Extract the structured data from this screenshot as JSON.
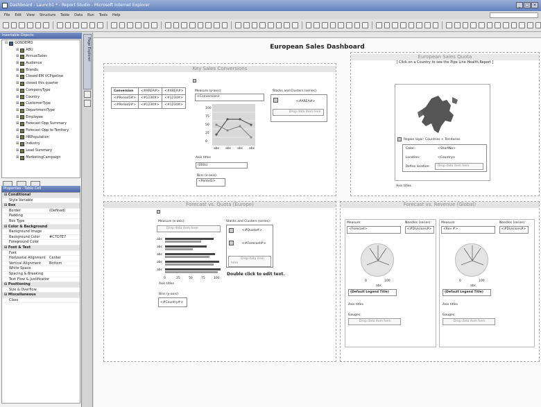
{
  "window": {
    "title": "Dashboard - Launch1 * - Report Studio - Microsoft Internet Explorer"
  },
  "menu": [
    "File",
    "Edit",
    "View",
    "Structure",
    "Table",
    "Data",
    "Run",
    "Tools",
    "Help"
  ],
  "left": {
    "objects_title": "Insertable Objects",
    "tree_root": "GOSDEMO",
    "tree": [
      "ABU",
      "AnnualSales",
      "Audience",
      "Brands",
      "Closed EM VCPipeline",
      "closed this quarter",
      "CompanyType",
      "Country",
      "CustomerType",
      "DepartmentType",
      "Employee",
      "Forecast Opp Summary",
      "Forecast Opp to Territory",
      "HRPopulation",
      "Industry",
      "Lead Summary",
      "MarketingCampaign"
    ],
    "props_title": "Properties - Table Cell",
    "props": [
      {
        "k": "Conditional",
        "v": "",
        "sec": true
      },
      {
        "k": "Style Variable",
        "v": ""
      },
      {
        "k": "Box",
        "v": "",
        "sec": true
      },
      {
        "k": "Border",
        "v": "(Defined)"
      },
      {
        "k": "Padding",
        "v": ""
      },
      {
        "k": "Box Type",
        "v": ""
      },
      {
        "k": "Color & Background",
        "v": "",
        "sec": true
      },
      {
        "k": "Background Image",
        "v": ""
      },
      {
        "k": "Background Color",
        "v": "#C7D7E7"
      },
      {
        "k": "Foreground Color",
        "v": ""
      },
      {
        "k": "Font & Text",
        "v": "",
        "sec": true
      },
      {
        "k": "Font",
        "v": ""
      },
      {
        "k": "Horizontal Alignment",
        "v": "Center"
      },
      {
        "k": "Vertical Alignment",
        "v": "Bottom"
      },
      {
        "k": "White Space",
        "v": ""
      },
      {
        "k": "Spacing & Breaking",
        "v": ""
      },
      {
        "k": "Text Flow & Justification",
        "v": ""
      },
      {
        "k": "Positioning",
        "v": "",
        "sec": true
      },
      {
        "k": "Size & Overflow",
        "v": ""
      },
      {
        "k": "Miscellaneous",
        "v": "",
        "sec": true
      },
      {
        "k": "Class",
        "v": ""
      }
    ]
  },
  "side": {
    "page_explorer": "Page Explorer"
  },
  "dash": {
    "title": "European Sales Dashboard",
    "kpi": {
      "title": "Key Sales Conversions",
      "crosstab": [
        [
          "Conversion",
          "<#AREA#>",
          "<#AREA#>"
        ],
        [
          "<#Period1#>",
          "<#1234#>",
          "<#1234#>"
        ],
        [
          "<#Period2#>",
          "<#1234#>",
          "<#1234#>"
        ]
      ],
      "measure_label": "Measure (y-axis):",
      "measure": "<Conversion>",
      "series_label": "Stacks and Clusters (series):",
      "series": "<#AREA#>",
      "drop": "Drop data item here",
      "yticks": [
        "100",
        "75",
        "50",
        "25",
        "0"
      ],
      "xticks": [
        "abc",
        "abc",
        "abc",
        "abc"
      ],
      "axis_titles": "Axis titles",
      "axis_box": "(000s)",
      "bins_label": "Bins (x-axis):",
      "bins": "<Period1>"
    },
    "quota": {
      "title": "European Sales Quota",
      "sub": "[ Click on a Country to see the Pipe Line Health Report ]",
      "region": "Region layer: Countries + Territories",
      "color_k": "Color:",
      "color_v": "<ShortNo>",
      "loc_k": "Location:",
      "loc_v": "<Country>",
      "refine_k": "Refine location:",
      "drop": "Drop data item here",
      "axis_titles": "Axis titles"
    },
    "fq": {
      "title": "Forecast vs. Quota (Europe)",
      "measure_label": "Measure (x-axis):",
      "drop": "Drop data item here",
      "series_label": "Stacks and Clusters (series):",
      "s1": "<#Quota#>",
      "s2": "<#Forecast#>",
      "drop2": "Drop data item here",
      "cats": [
        "abc",
        "abc",
        "abc",
        "abc",
        "abc"
      ],
      "xticks": [
        "0",
        "25",
        "50",
        "75",
        "100"
      ],
      "dbl": "Double click to edit text.",
      "axis_titles": "Axis titles",
      "bins_label": "Bins (y-axis):",
      "bins": "<#Country#>"
    },
    "fr": {
      "title": "Forecast vs. Revenue (Global)",
      "g1": {
        "measure_label": "Measure:",
        "measure": "<Forecast>",
        "needle_label": "Needles (series):",
        "needle": "<#Divisions#>",
        "ticks": [
          "0",
          "100"
        ],
        "axis": "abc",
        "legend": "(Default Legend Title)",
        "axis_titles": "Axis titles",
        "gauges": "Gauges:",
        "drop": "Drop data item here"
      },
      "g2": {
        "measure_label": "Measure:",
        "measure": "<Rev #>",
        "needle_label": "Needles (series):",
        "needle": "<#Divisions#>",
        "ticks": [
          "0",
          "100"
        ],
        "axis": "abc",
        "legend": "(Default Legend Title)",
        "axis_titles": "Axis titles",
        "gauges": "Gauges:",
        "drop": "Drop data item here"
      }
    }
  }
}
